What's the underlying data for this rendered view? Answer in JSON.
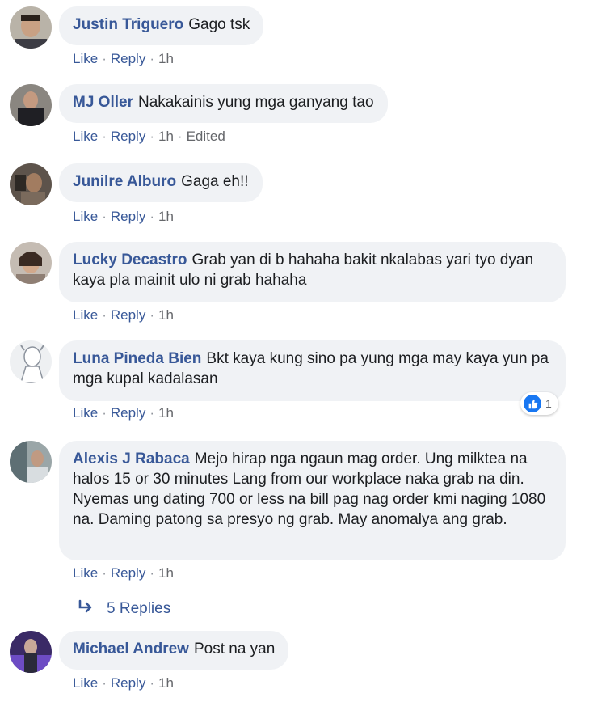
{
  "actions": {
    "like": "Like",
    "reply": "Reply",
    "dot": "·"
  },
  "comments": [
    {
      "author": "Justin Triguero",
      "text": "Gago tsk",
      "time": "1h",
      "edited": ""
    },
    {
      "author": "MJ Oller",
      "text": "Nakakainis yung mga ganyang tao",
      "time": "1h",
      "edited": "Edited"
    },
    {
      "author": "Junilre Alburo",
      "text": "Gaga eh!!",
      "time": "1h",
      "edited": ""
    },
    {
      "author": "Lucky Decastro",
      "text": "Grab yan di b hahaha bakit nkalabas yari tyo dyan kaya pla mainit ulo ni grab hahaha",
      "time": "1h",
      "edited": ""
    },
    {
      "author": "Luna Pineda Bien",
      "text": "Bkt kaya kung sino pa yung mga may kaya yun pa mga kupal kadalasan",
      "time": "1h",
      "edited": "",
      "reaction_count": "1"
    },
    {
      "author": "Alexis J Rabaca",
      "text": "Mejo hirap nga ngaun mag order. Ung milktea na halos 15 or 30 minutes Lang from our workplace naka grab na din. Nyemas ung dating 700 or less na bill pag nag order kmi naging 1080 na. Daming patong sa presyo ng grab. May anomalya ang grab.",
      "time": "1h",
      "edited": ""
    },
    {
      "author": "Michael Andrew",
      "text": "Post na yan",
      "time": "1h",
      "edited": ""
    }
  ],
  "replies_link": "5 Replies",
  "colors": {
    "name": "#385898",
    "bubble": "#f0f2f5",
    "meta": "#65676b",
    "like_badge": "#1877f2"
  }
}
